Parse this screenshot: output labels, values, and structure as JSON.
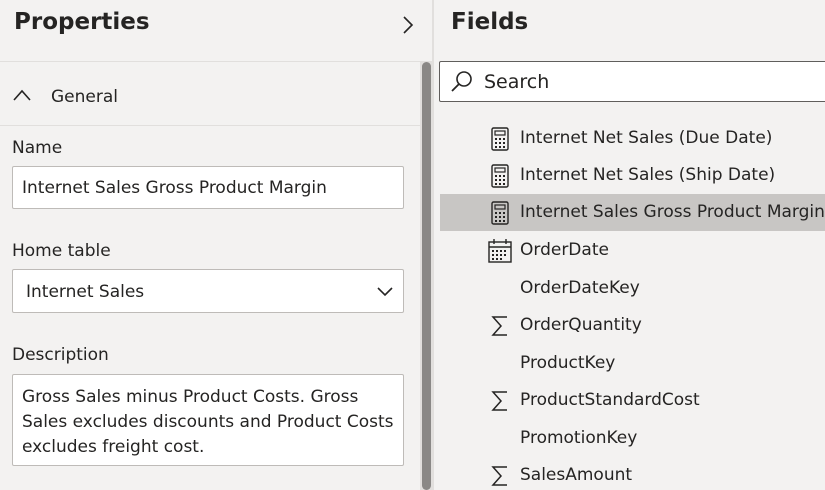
{
  "properties": {
    "title": "Properties",
    "section_label": "General",
    "name_label": "Name",
    "name_value": "Internet Sales Gross Product Margin",
    "home_table_label": "Home table",
    "home_table_value": "Internet Sales",
    "description_label": "Description",
    "description_value": "Gross Sales minus Product Costs. Gross Sales excludes discounts and Product Costs excludes freight cost."
  },
  "fields": {
    "title": "Fields",
    "search_placeholder": "Search",
    "selected_item": "Internet Sales Gross Product Margin",
    "items": [
      {
        "label": "Internet Net Sales (Due Date)",
        "icon": "calculator-icon"
      },
      {
        "label": "Internet Net Sales (Ship Date)",
        "icon": "calculator-icon"
      },
      {
        "label": "Internet Sales Gross Product Margin",
        "icon": "calculator-icon"
      },
      {
        "label": "OrderDate",
        "icon": "calendar-icon"
      },
      {
        "label": "OrderDateKey",
        "icon": "none"
      },
      {
        "label": "OrderQuantity",
        "icon": "sigma-icon"
      },
      {
        "label": "ProductKey",
        "icon": "none"
      },
      {
        "label": "ProductStandardCost",
        "icon": "sigma-icon"
      },
      {
        "label": "PromotionKey",
        "icon": "none"
      },
      {
        "label": "SalesAmount",
        "icon": "sigma-icon"
      }
    ]
  },
  "colors": {
    "background": "#f3f2f1",
    "selected_row": "#c8c6c4",
    "input_background": "#ffffff",
    "text": "#252423"
  }
}
